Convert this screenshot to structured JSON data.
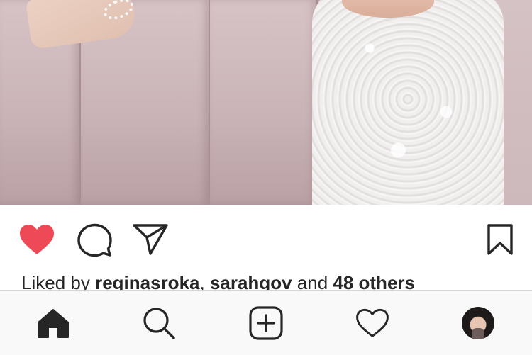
{
  "post": {
    "photo_description": "photo",
    "likes": {
      "prefix": "Liked by ",
      "user1": "reginasroka",
      "separator": ", ",
      "user2": "sarahgov",
      "middle": " and ",
      "others": "48 others"
    }
  },
  "actions": {
    "like_icon": "heart-filled-icon",
    "comment_icon": "comment-bubble-icon",
    "share_icon": "paper-plane-icon",
    "save_icon": "bookmark-icon"
  },
  "tab_bar": {
    "items": [
      {
        "icon": "home-icon"
      },
      {
        "icon": "search-icon"
      },
      {
        "icon": "plus-square-icon"
      },
      {
        "icon": "heart-outline-icon"
      },
      {
        "icon": "profile-avatar"
      }
    ]
  },
  "colors": {
    "like_red": "#ed4956",
    "icon_dark": "#262626",
    "tab_bar_bg": "#f9f9f9"
  }
}
